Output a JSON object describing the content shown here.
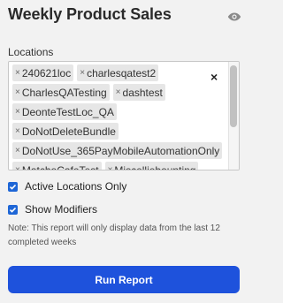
{
  "header": {
    "title": "Weekly Product Sales",
    "visibility_icon": "eye-icon"
  },
  "locations": {
    "label": "Locations",
    "clear_all": "×",
    "tags": [
      "240621loc",
      "charlesqatest2",
      "CharlesQATesting",
      "dashtest",
      "DeonteTestLoc_QA",
      "DoNotDeleteBundle",
      "DoNotUse_365PayMobileAutomationOnly",
      "MatchoCafeTest",
      "Miscelliebounting"
    ],
    "tag_remove": "×"
  },
  "options": {
    "active_only_label": "Active Locations Only",
    "active_only_checked": true,
    "show_modifiers_label": "Show Modifiers",
    "show_modifiers_checked": true
  },
  "note": "Note: This report will only display data from the last 12 completed weeks",
  "actions": {
    "run_label": "Run Report"
  },
  "colors": {
    "accent": "#1e52dc",
    "checkbox": "#1e66d6",
    "background": "#f2f2f2"
  }
}
